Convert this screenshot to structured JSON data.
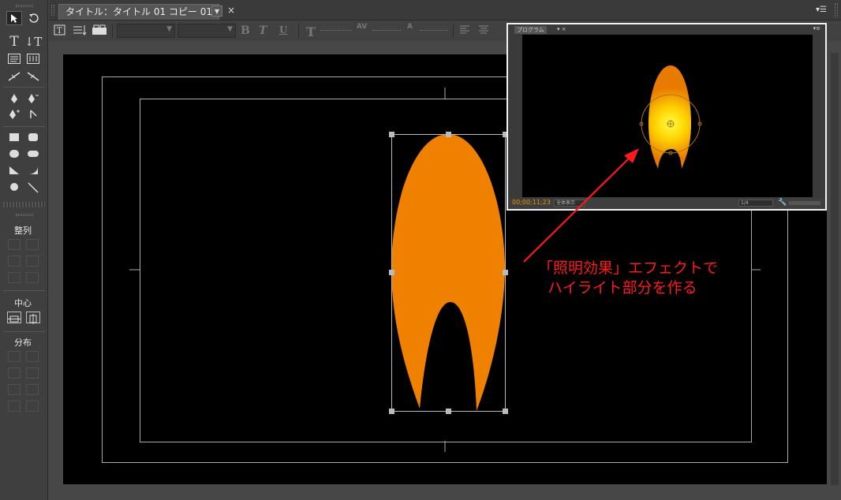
{
  "tab": {
    "title": "タイトル：タイトル 01 コピー 01"
  },
  "tools_panel": {
    "type_tool_glyph": "T",
    "vertical_type_glyph": "↓T",
    "align_label": "整列",
    "center_label": "中心",
    "distribute_label": "分布"
  },
  "toolbar": {
    "bold_glyph": "B",
    "italic_glyph": "T",
    "underline_glyph": "U",
    "size_glyph": "T",
    "kerning_glyph": "AV",
    "leading_glyph": "A"
  },
  "mini_monitor": {
    "tab_label": "プログラム",
    "timecode": "00;00;11;23",
    "zoom_select": "全体表示",
    "resolution_select": "1/4"
  },
  "annotation": {
    "line1": "「照明効果」エフェクトで",
    "line2": "ハイライト部分を作る"
  },
  "colors": {
    "flame_orange": "#f08000",
    "annotation_red": "#ff1a1a",
    "timecode_amber": "#e89a00",
    "highlight_yellow": "#ffff30"
  }
}
